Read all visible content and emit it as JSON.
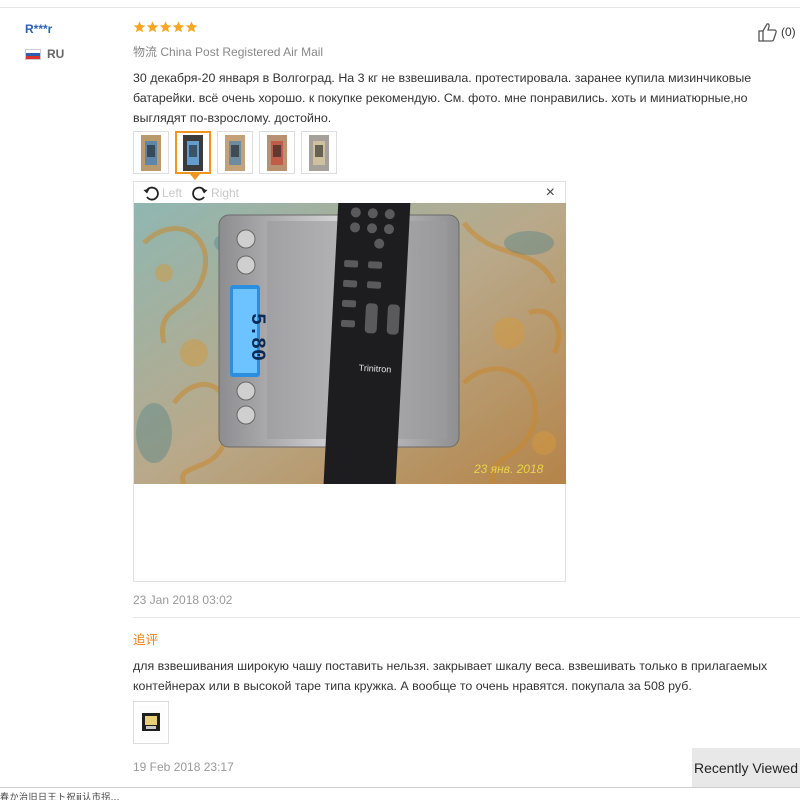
{
  "reviewer": {
    "name": "R***r",
    "country": "RU",
    "flag_colors": [
      "#ffffff",
      "#2b5fb4",
      "#d8342f"
    ]
  },
  "review": {
    "rating": 5,
    "star_color": "#f5a623",
    "shipping_prefix": "物流",
    "shipping_method": "China Post Registered Air Mail",
    "helpful_count": "(0)",
    "text": "30 декабря-20 января в Волгоград. На 3 кг не взвешивала. протестировала. заранее купила мизинчиковые батарейки. всё очень хорошо. к покупке рекомендую. См. фото. мне понравились. хоть и миниатюрные,но выглядят по-взрослому. достойно.",
    "thumbnails": [
      {
        "icon": "photo-thumbnail-icon",
        "active": false
      },
      {
        "icon": "photo-thumbnail-icon",
        "active": true
      },
      {
        "icon": "photo-thumbnail-icon",
        "active": false
      },
      {
        "icon": "photo-thumbnail-icon",
        "active": false
      },
      {
        "icon": "photo-thumbnail-icon",
        "active": false
      }
    ],
    "date": "23 Jan 2018 03:02"
  },
  "viewer": {
    "rotate_left_label": "Left",
    "rotate_right_label": "Right",
    "close_symbol": "×",
    "scale_reading": "5.80",
    "photo_date_stamp": "23 янв. 2018",
    "remote_brand": "Trinitron"
  },
  "followup": {
    "label": "追评",
    "label_color": "#f07d17",
    "text": "для взвешивания широкую чашу поставить нельзя. закрывает шкалу веса. взвешивать только в прилагаемых контейнерах или в высокой таре типа кружка. А вообще то очень нравятся. покупала за 508 руб.",
    "date": "19 Feb 2018 23:17"
  },
  "recently_viewed": {
    "label": "Recently Viewed"
  },
  "footer": {
    "garbled_text": "春か治旧日王ト祝ⅲ认市拐..."
  }
}
